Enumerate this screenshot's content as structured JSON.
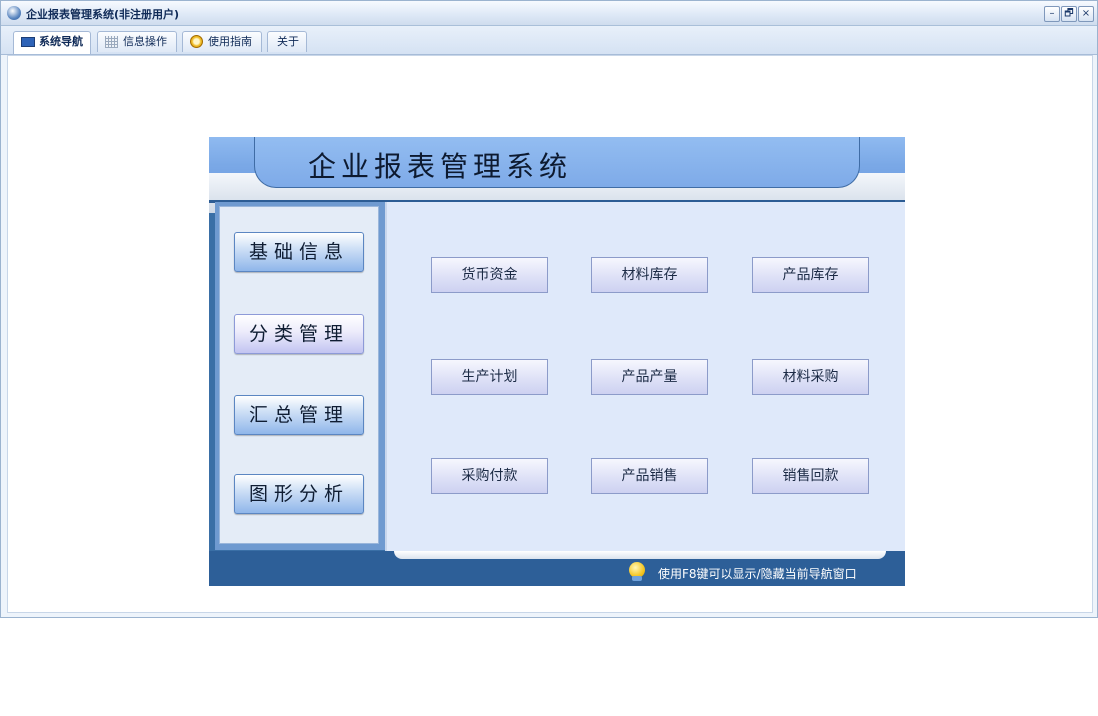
{
  "window": {
    "title": "企业报表管理系统(非注册用户)",
    "controls": {
      "minimize": "–",
      "restore": "🗗",
      "close": "×"
    }
  },
  "tabs": [
    {
      "label": "系统导航",
      "icon": "monitor-icon",
      "active": true
    },
    {
      "label": "信息操作",
      "icon": "grid-icon",
      "active": false
    },
    {
      "label": "使用指南",
      "icon": "clock-icon",
      "active": false
    },
    {
      "label": "关于",
      "icon": "",
      "active": false
    }
  ],
  "banner": {
    "title": "企业报表管理系统"
  },
  "categories": [
    {
      "label": "基础信息",
      "active": false
    },
    {
      "label": "分类管理",
      "active": true
    },
    {
      "label": "汇总管理",
      "active": false
    },
    {
      "label": "图形分析",
      "active": false
    }
  ],
  "functions": [
    "货币资金",
    "材料库存",
    "产品库存",
    "生产计划",
    "产品产量",
    "材料采购",
    "采购付款",
    "产品销售",
    "销售回款"
  ],
  "footer": {
    "hint": "使用F8键可以显示/隐藏当前导航窗口",
    "hint_icon": "lightbulb-icon"
  },
  "colors": {
    "accent": "#3a6fa6",
    "banner": "#7eaae8",
    "main_bg": "#dfe9fa"
  }
}
